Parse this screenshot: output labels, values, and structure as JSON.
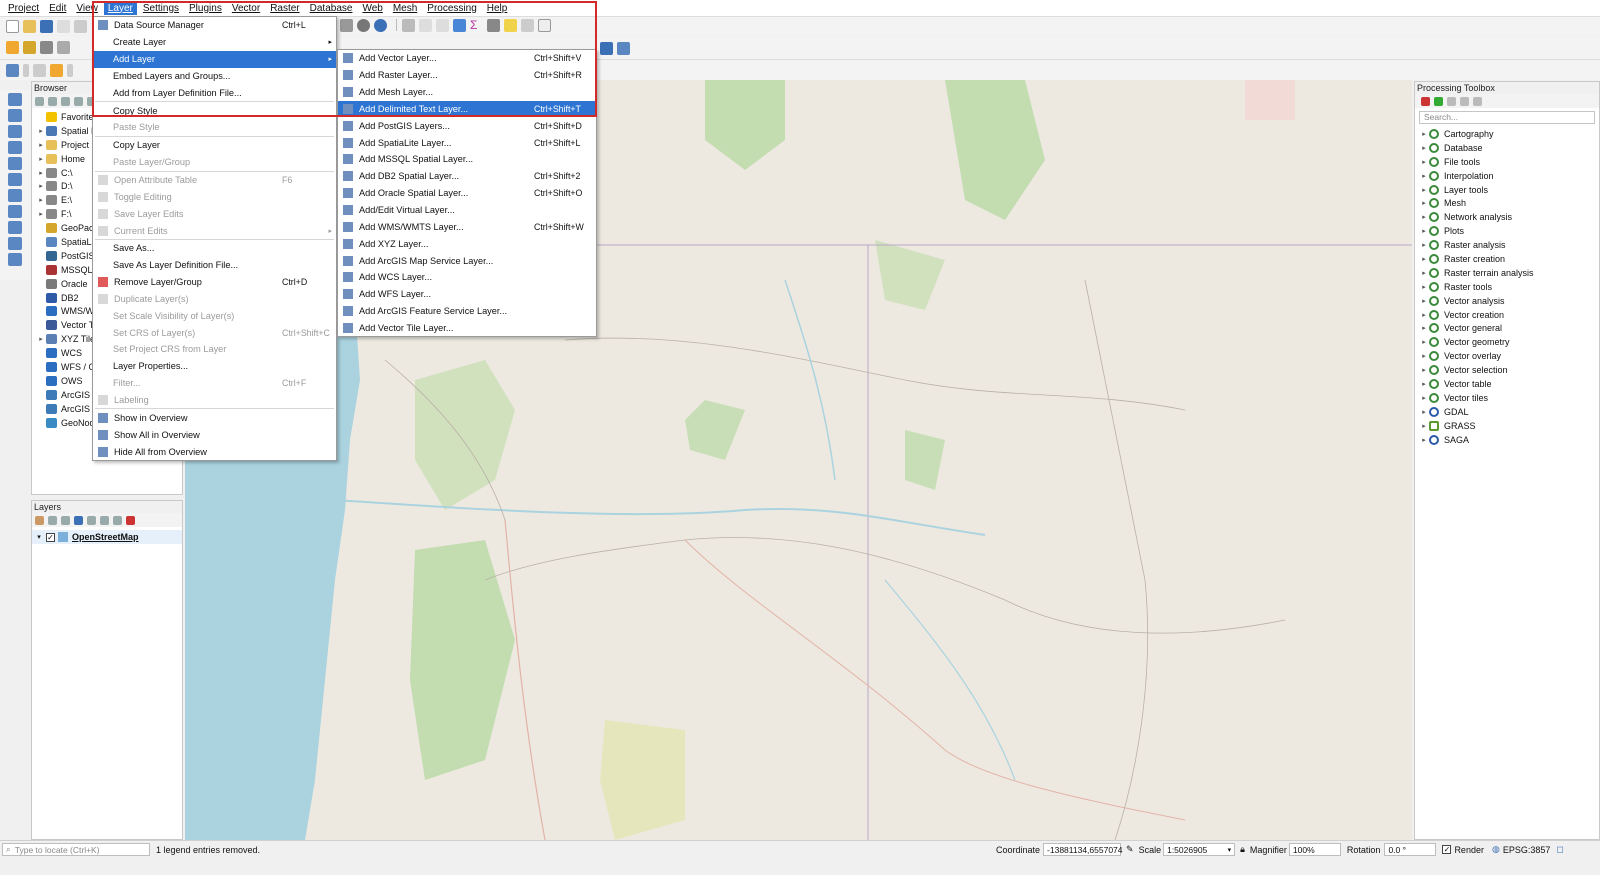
{
  "menubar": [
    "Project",
    "Edit",
    "View",
    "Layer",
    "Settings",
    "Plugins",
    "Vector",
    "Raster",
    "Database",
    "Web",
    "Mesh",
    "Processing",
    "Help"
  ],
  "active_menu": "Layer",
  "browser": {
    "title": "Browser",
    "items": [
      {
        "label": "Favorites",
        "arrow": "",
        "icon": "star-icon",
        "color": "#f2c100"
      },
      {
        "label": "Spatial Bookmarks",
        "arrow": "▸",
        "icon": "bookmark-icon",
        "color": "#4a78b5"
      },
      {
        "label": "Project Home",
        "arrow": "▸",
        "icon": "folder-icon",
        "color": "#e8c05a"
      },
      {
        "label": "Home",
        "arrow": "▸",
        "icon": "folder-icon",
        "color": "#e8c05a"
      },
      {
        "label": "C:\\",
        "arrow": "▸",
        "icon": "drive-icon",
        "color": "#888888"
      },
      {
        "label": "D:\\",
        "arrow": "▸",
        "icon": "drive-icon",
        "color": "#888888"
      },
      {
        "label": "E:\\",
        "arrow": "▸",
        "icon": "drive-icon",
        "color": "#888888"
      },
      {
        "label": "F:\\",
        "arrow": "▸",
        "icon": "drive-icon",
        "color": "#888888"
      },
      {
        "label": "GeoPackage",
        "arrow": "",
        "icon": "geopackage-icon",
        "color": "#d4a72c"
      },
      {
        "label": "SpatiaLite",
        "arrow": "",
        "icon": "spatialite-icon",
        "color": "#5a86c2"
      },
      {
        "label": "PostGIS",
        "arrow": "",
        "icon": "postgis-icon",
        "color": "#336791"
      },
      {
        "label": "MSSQL",
        "arrow": "",
        "icon": "mssql-icon",
        "color": "#a33"
      },
      {
        "label": "Oracle",
        "arrow": "",
        "icon": "oracle-icon",
        "color": "#7a7a7a"
      },
      {
        "label": "DB2",
        "arrow": "",
        "icon": "db2-icon",
        "color": "#2e5aa8"
      },
      {
        "label": "WMS/WMTS",
        "arrow": "",
        "icon": "wms-icon",
        "color": "#2b6dbf"
      },
      {
        "label": "Vector Tiles",
        "arrow": "",
        "icon": "vector-tiles-icon",
        "color": "#3b5998"
      },
      {
        "label": "XYZ Tiles",
        "arrow": "▸",
        "icon": "xyz-icon",
        "color": "#5b7fb3"
      },
      {
        "label": "WCS",
        "arrow": "",
        "icon": "wcs-icon",
        "color": "#2b6dbf"
      },
      {
        "label": "WFS / OGC API - Features",
        "arrow": "",
        "icon": "wfs-icon",
        "color": "#2b6dbf"
      },
      {
        "label": "OWS",
        "arrow": "",
        "icon": "ows-icon",
        "color": "#2b6dbf"
      },
      {
        "label": "ArcGIS Map Service",
        "arrow": "",
        "icon": "arcgis-icon",
        "color": "#3d7ab8"
      },
      {
        "label": "ArcGIS Feature Service",
        "arrow": "",
        "icon": "arcgis-icon",
        "color": "#3d7ab8"
      },
      {
        "label": "GeoNode",
        "arrow": "",
        "icon": "geonode-icon",
        "color": "#3a8ac4"
      }
    ]
  },
  "layers": {
    "title": "Layers",
    "items": [
      {
        "label": "OpenStreetMap",
        "checked": true
      }
    ]
  },
  "toolbox": {
    "title": "Processing Toolbox",
    "search_placeholder": "Search...",
    "items": [
      {
        "label": "Cartography",
        "icon": "processing-icon"
      },
      {
        "label": "Database",
        "icon": "processing-icon"
      },
      {
        "label": "File tools",
        "icon": "processing-icon"
      },
      {
        "label": "Interpolation",
        "icon": "processing-icon"
      },
      {
        "label": "Layer tools",
        "icon": "processing-icon"
      },
      {
        "label": "Mesh",
        "icon": "processing-icon"
      },
      {
        "label": "Network analysis",
        "icon": "processing-icon"
      },
      {
        "label": "Plots",
        "icon": "processing-icon"
      },
      {
        "label": "Raster analysis",
        "icon": "processing-icon"
      },
      {
        "label": "Raster creation",
        "icon": "processing-icon"
      },
      {
        "label": "Raster terrain analysis",
        "icon": "processing-icon"
      },
      {
        "label": "Raster tools",
        "icon": "processing-icon"
      },
      {
        "label": "Vector analysis",
        "icon": "processing-icon"
      },
      {
        "label": "Vector creation",
        "icon": "processing-icon"
      },
      {
        "label": "Vector general",
        "icon": "processing-icon"
      },
      {
        "label": "Vector geometry",
        "icon": "processing-icon"
      },
      {
        "label": "Vector overlay",
        "icon": "processing-icon"
      },
      {
        "label": "Vector selection",
        "icon": "processing-icon"
      },
      {
        "label": "Vector table",
        "icon": "processing-icon"
      },
      {
        "label": "Vector tiles",
        "icon": "processing-icon"
      },
      {
        "label": "GDAL",
        "icon": "gdal-icon"
      },
      {
        "label": "GRASS",
        "icon": "grass-icon"
      },
      {
        "label": "SAGA",
        "icon": "saga-icon"
      }
    ]
  },
  "layer_menu": {
    "items": [
      {
        "type": "item",
        "label": "Data Source Manager",
        "shortcut": "Ctrl+L",
        "icon": "data-source-icon",
        "disabled": false
      },
      {
        "type": "item",
        "label": "Create Layer",
        "shortcut": "",
        "submenu": true,
        "disabled": false
      },
      {
        "type": "item",
        "label": "Add Layer",
        "shortcut": "",
        "submenu": true,
        "highlight": true,
        "disabled": false
      },
      {
        "type": "item",
        "label": "Embed Layers and Groups...",
        "shortcut": "",
        "disabled": false
      },
      {
        "type": "item",
        "label": "Add from Layer Definition File...",
        "shortcut": "",
        "disabled": false
      },
      {
        "type": "sep"
      },
      {
        "type": "item",
        "label": "Copy Style",
        "shortcut": "",
        "disabled": false
      },
      {
        "type": "item",
        "label": "Paste Style",
        "shortcut": "",
        "disabled": true
      },
      {
        "type": "sep"
      },
      {
        "type": "item",
        "label": "Copy Layer",
        "shortcut": "",
        "disabled": false
      },
      {
        "type": "item",
        "label": "Paste Layer/Group",
        "shortcut": "",
        "disabled": true
      },
      {
        "type": "sep"
      },
      {
        "type": "item",
        "label": "Open Attribute Table",
        "shortcut": "F6",
        "icon": "table-icon",
        "disabled": true
      },
      {
        "type": "item",
        "label": "Toggle Editing",
        "shortcut": "",
        "icon": "pencil-icon",
        "disabled": true
      },
      {
        "type": "item",
        "label": "Save Layer Edits",
        "shortcut": "",
        "icon": "save-edits-icon",
        "disabled": true
      },
      {
        "type": "item",
        "label": "Current Edits",
        "shortcut": "",
        "submenu": true,
        "icon": "edits-icon",
        "disabled": true
      },
      {
        "type": "sep"
      },
      {
        "type": "item",
        "label": "Save As...",
        "shortcut": "",
        "disabled": false
      },
      {
        "type": "item",
        "label": "Save As Layer Definition File...",
        "shortcut": "",
        "disabled": false
      },
      {
        "type": "item",
        "label": "Remove Layer/Group",
        "shortcut": "Ctrl+D",
        "icon": "remove-icon",
        "disabled": false
      },
      {
        "type": "item",
        "label": "Duplicate Layer(s)",
        "shortcut": "",
        "icon": "duplicate-icon",
        "disabled": true
      },
      {
        "type": "item",
        "label": "Set Scale Visibility of Layer(s)",
        "shortcut": "",
        "disabled": true
      },
      {
        "type": "item",
        "label": "Set CRS of Layer(s)",
        "shortcut": "Ctrl+Shift+C",
        "disabled": true
      },
      {
        "type": "item",
        "label": "Set Project CRS from Layer",
        "shortcut": "",
        "disabled": true
      },
      {
        "type": "item",
        "label": "Layer Properties...",
        "shortcut": "",
        "disabled": false
      },
      {
        "type": "item",
        "label": "Filter...",
        "shortcut": "Ctrl+F",
        "disabled": true
      },
      {
        "type": "item",
        "label": "Labeling",
        "shortcut": "",
        "icon": "labeling-icon",
        "disabled": true
      },
      {
        "type": "sep"
      },
      {
        "type": "item",
        "label": "Show in Overview",
        "shortcut": "",
        "icon": "overview-icon",
        "disabled": false
      },
      {
        "type": "item",
        "label": "Show All in Overview",
        "shortcut": "",
        "icon": "overview-icon",
        "disabled": false
      },
      {
        "type": "item",
        "label": "Hide All from Overview",
        "shortcut": "",
        "icon": "overview-icon",
        "disabled": false
      }
    ]
  },
  "add_layer_menu": {
    "items": [
      {
        "label": "Add Vector Layer...",
        "shortcut": "Ctrl+Shift+V",
        "icon": "vector-layer-icon"
      },
      {
        "label": "Add Raster Layer...",
        "shortcut": "Ctrl+Shift+R",
        "icon": "raster-layer-icon"
      },
      {
        "label": "Add Mesh Layer...",
        "shortcut": "",
        "icon": "mesh-layer-icon"
      },
      {
        "label": "Add Delimited Text Layer...",
        "shortcut": "Ctrl+Shift+T",
        "icon": "delimited-text-icon",
        "highlight": true
      },
      {
        "label": "Add PostGIS Layers...",
        "shortcut": "Ctrl+Shift+D",
        "icon": "postgis-icon"
      },
      {
        "label": "Add SpatiaLite Layer...",
        "shortcut": "Ctrl+Shift+L",
        "icon": "spatialite-icon"
      },
      {
        "label": "Add MSSQL Spatial Layer...",
        "shortcut": "",
        "icon": "mssql-icon"
      },
      {
        "label": "Add DB2 Spatial Layer...",
        "shortcut": "Ctrl+Shift+2",
        "icon": "db2-icon"
      },
      {
        "label": "Add Oracle Spatial Layer...",
        "shortcut": "Ctrl+Shift+O",
        "icon": "oracle-icon"
      },
      {
        "label": "Add/Edit Virtual Layer...",
        "shortcut": "",
        "icon": "virtual-layer-icon"
      },
      {
        "label": "Add WMS/WMTS Layer...",
        "shortcut": "Ctrl+Shift+W",
        "icon": "wms-icon"
      },
      {
        "label": "Add XYZ Layer...",
        "shortcut": "",
        "icon": "xyz-icon"
      },
      {
        "label": "Add ArcGIS Map Service Layer...",
        "shortcut": "",
        "icon": "arcgis-icon"
      },
      {
        "label": "Add WCS Layer...",
        "shortcut": "",
        "icon": "wcs-icon"
      },
      {
        "label": "Add WFS Layer...",
        "shortcut": "",
        "icon": "wfs-icon"
      },
      {
        "label": "Add ArcGIS Feature Service Layer...",
        "shortcut": "",
        "icon": "arcgis-icon"
      },
      {
        "label": "Add Vector Tile Layer...",
        "shortcut": "",
        "icon": "vector-tile-icon"
      }
    ]
  },
  "status": {
    "locate_placeholder": "Type to locate (Ctrl+K)",
    "message": "1 legend entries removed.",
    "coordinate_label": "Coordinate",
    "coordinate": "-13881134,6557074",
    "scale_label": "Scale",
    "scale": "1:5026905",
    "magnifier_label": "Magnifier",
    "magnifier": "100%",
    "rotation_label": "Rotation",
    "rotation": "0.0 °",
    "render_label": "Render",
    "crs": "EPSG:3857"
  },
  "colors": {
    "highlight": "#2d74d3",
    "water": "#aad3df",
    "forest": "#b8d8a4",
    "red_box": "#d12a2a"
  }
}
